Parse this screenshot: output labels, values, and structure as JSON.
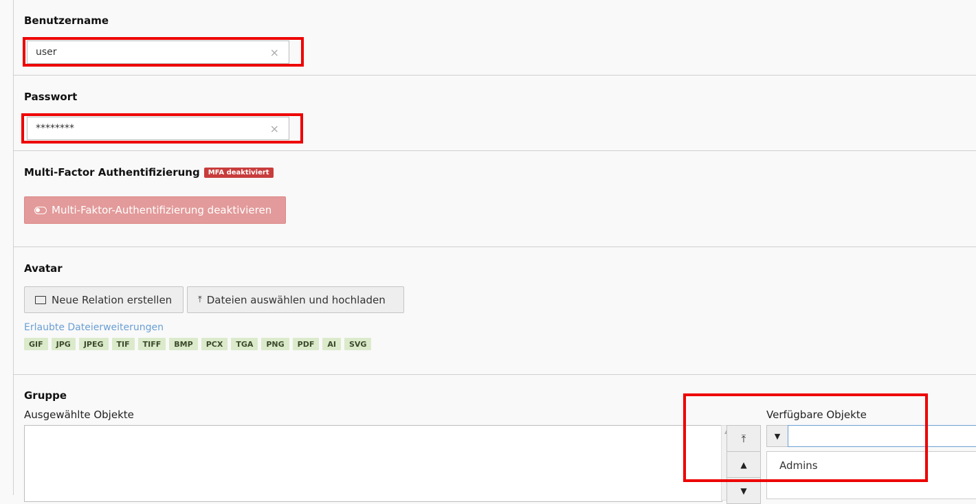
{
  "username": {
    "label": "Benutzername",
    "value": "user"
  },
  "password": {
    "label": "Passwort",
    "value": "********"
  },
  "mfa": {
    "label": "Multi-Factor Authentifizierung",
    "badge": "MFA deaktiviert",
    "button": "Multi-Faktor-Authentifizierung deaktivieren",
    "badge_color": "#c83c3c"
  },
  "avatar": {
    "label": "Avatar",
    "new_relation": "Neue Relation erstellen",
    "upload": "Dateien auswählen und hochladen",
    "allowed_link": "Erlaubte Dateierweiterungen",
    "extensions": [
      "GIF",
      "JPG",
      "JPEG",
      "TIF",
      "TIFF",
      "BMP",
      "PCX",
      "TGA",
      "PNG",
      "PDF",
      "AI",
      "SVG"
    ]
  },
  "group": {
    "label": "Gruppe",
    "selected_label": "Ausgewählte Objekte",
    "available_label": "Verfügbare Objekte",
    "filter_value": "",
    "available_items": [
      "Admins"
    ]
  },
  "icons": {
    "clear": "×",
    "move_top": "⤒",
    "move_up": "▲",
    "move_down": "▼",
    "filter": "▼",
    "scroll_up": "▲"
  }
}
